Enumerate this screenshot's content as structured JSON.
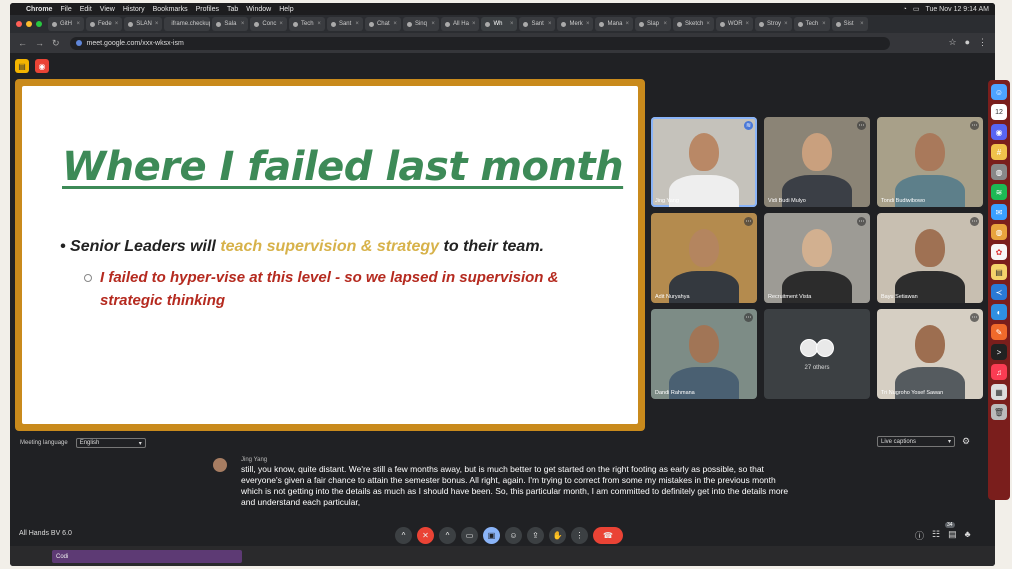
{
  "menubar": {
    "apple": "",
    "app": "Chrome",
    "items": [
      "File",
      "Edit",
      "View",
      "History",
      "Bookmarks",
      "Profiles",
      "Tab",
      "Window",
      "Help"
    ],
    "clock": "Tue Nov 12 9:14 AM"
  },
  "tabs": [
    {
      "label": "GitH"
    },
    {
      "label": "Fede"
    },
    {
      "label": "SLAN"
    },
    {
      "label": "iframe.checkup"
    },
    {
      "label": "Sala"
    },
    {
      "label": "Conc"
    },
    {
      "label": "Tech"
    },
    {
      "label": "Sant"
    },
    {
      "label": "Chat"
    },
    {
      "label": "Sinq"
    },
    {
      "label": "All Ha"
    },
    {
      "label": "Wh",
      "active": true
    },
    {
      "label": "Sant"
    },
    {
      "label": "Merk"
    },
    {
      "label": "Mana"
    },
    {
      "label": "Slap"
    },
    {
      "label": "Sketch"
    },
    {
      "label": "WOR"
    },
    {
      "label": "Stroy"
    },
    {
      "label": "Tech"
    },
    {
      "label": "Sist"
    }
  ],
  "url": "meet.google.com/xxx-wksx-ism",
  "slide": {
    "title": "Where I failed last month",
    "bullet1_pre": "• Senior Leaders will ",
    "bullet1_hl": "teach supervision & strategy",
    "bullet1_post": " to their team.",
    "bullet2": "I failed to hyper-vise at this level - so we lapsed in supervision & strategic thinking"
  },
  "participants": [
    {
      "name": "Jing Yang",
      "bg": "#c5c2bb",
      "skin": "#b98866",
      "shirt": "#eeeeee",
      "active": true
    },
    {
      "name": "Vidi Budi Mulyo",
      "bg": "#8b8476",
      "skin": "#c9a07e",
      "shirt": "#3b3f46"
    },
    {
      "name": "Tondi Budiwibowo",
      "bg": "#a8a089",
      "skin": "#a9795b",
      "shirt": "#5d7f8a"
    },
    {
      "name": "Adit Nuryahya",
      "bg": "#b48b4e",
      "skin": "#b4855f",
      "shirt": "#34393f"
    },
    {
      "name": "Recruitment Vista",
      "bg": "#9d9b95",
      "skin": "#d2b090",
      "shirt": "#2c2c2c"
    },
    {
      "name": "Bayu Setiawan",
      "bg": "#c8bfb1",
      "skin": "#9f7153",
      "shirt": "#2d2d2d"
    },
    {
      "name": "Dandi Rahmana",
      "bg": "#7d8c86",
      "skin": "#a17556",
      "shirt": "#4a6072"
    },
    {
      "name": "27 others"
    },
    {
      "name": "Tri Nugroho Yosef Sawan",
      "bg": "#d6cfc3",
      "skin": "#9d6e50",
      "shirt": "#555b5f"
    }
  ],
  "meeting_language_label": "Meeting language",
  "meeting_language": "English",
  "captions_mode": "Live captions",
  "speaker": "Jing Yang",
  "caption": "still, you know, quite distant. We're still a few months away, but is much better to get started on the right footing as early as possible, so that everyone's given a fair chance to attain the semester bonus. All right, again. I'm trying to correct from some my mistakes in the previous month which is not getting into the details as much as I should have been. So, this particular month, I am committed to definitely get into the details more and understand each particular,",
  "meeting_name": "All Hands BV 6.0",
  "people_count": "34",
  "taskbar_item": "Codi",
  "dock_date": "12"
}
